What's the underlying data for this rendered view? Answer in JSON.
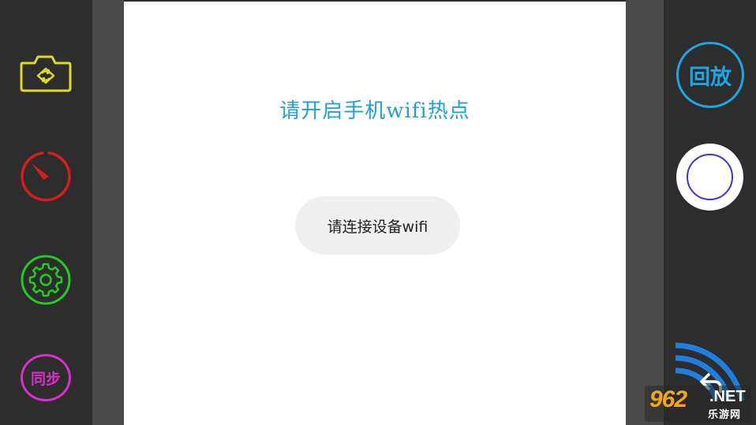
{
  "preview": {
    "message": "请开启手机wifi热点",
    "toast": "请连接设备wifi"
  },
  "controls": {
    "sync_label": "同步",
    "playback_label": "回放"
  },
  "watermark": {
    "number": "962",
    "suffix": ".NET",
    "site": "乐游网"
  },
  "icons": {
    "switch_camera": "camera-switch-icon",
    "timer": "timer-icon",
    "settings": "gear-icon",
    "wifi": "wifi-signal-icon",
    "back": "back-arrow-icon"
  },
  "colors": {
    "switch_camera": "#dcdc28",
    "timer": "#d81c1c",
    "settings": "#22cc22",
    "sync": "#d830c8",
    "playback": "#1fa6e2",
    "shutter_ring": "#3535d9",
    "wifi": "#1f7fe0",
    "message_text": "#1ea2d6"
  }
}
